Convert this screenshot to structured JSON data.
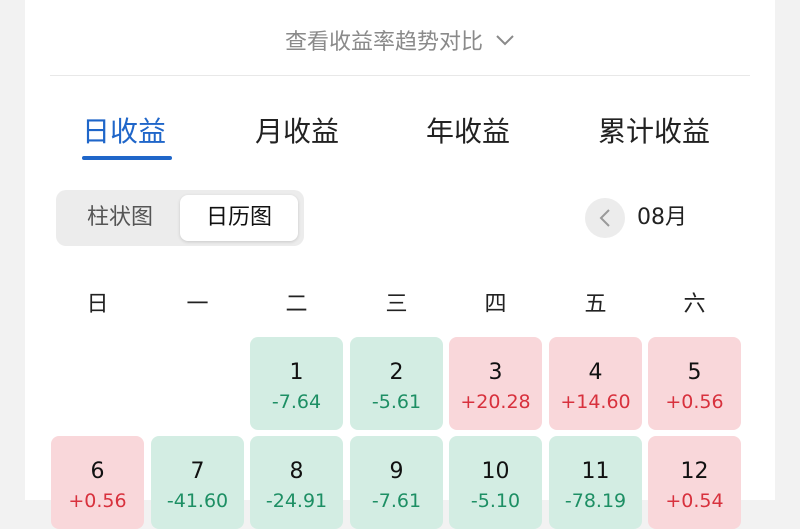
{
  "trend_link": {
    "label": "查看收益率趋势对比",
    "icon": "chevron-down-icon"
  },
  "tabs": [
    {
      "label": "日收益",
      "active": true
    },
    {
      "label": "月收益",
      "active": false
    },
    {
      "label": "年收益",
      "active": false
    },
    {
      "label": "累计收益",
      "active": false
    }
  ],
  "view_toggle": {
    "options": [
      {
        "label": "柱状图",
        "selected": false
      },
      {
        "label": "日历图",
        "selected": true
      }
    ]
  },
  "month_nav": {
    "prev_icon": "chevron-left-icon",
    "month": "08月"
  },
  "weekdays": [
    "日",
    "一",
    "二",
    "三",
    "四",
    "五",
    "六"
  ],
  "calendar": [
    {
      "day": "1",
      "value": "-7.64",
      "trend": "down",
      "col": 2,
      "week": 0
    },
    {
      "day": "2",
      "value": "-5.61",
      "trend": "down",
      "col": 3,
      "week": 0
    },
    {
      "day": "3",
      "value": "+20.28",
      "trend": "up",
      "col": 4,
      "week": 0
    },
    {
      "day": "4",
      "value": "+14.60",
      "trend": "up",
      "col": 5,
      "week": 0
    },
    {
      "day": "5",
      "value": "+0.56",
      "trend": "up",
      "col": 6,
      "week": 0
    },
    {
      "day": "6",
      "value": "+0.56",
      "trend": "up",
      "col": 0,
      "week": 1
    },
    {
      "day": "7",
      "value": "-41.60",
      "trend": "down",
      "col": 1,
      "week": 1
    },
    {
      "day": "8",
      "value": "-24.91",
      "trend": "down",
      "col": 2,
      "week": 1
    },
    {
      "day": "9",
      "value": "-7.61",
      "trend": "down",
      "col": 3,
      "week": 1
    },
    {
      "day": "10",
      "value": "-5.10",
      "trend": "down",
      "col": 4,
      "week": 1
    },
    {
      "day": "11",
      "value": "-78.19",
      "trend": "down",
      "col": 5,
      "week": 1
    },
    {
      "day": "12",
      "value": "+0.54",
      "trend": "up",
      "col": 6,
      "week": 1
    }
  ],
  "colors": {
    "accent": "#1f66c9",
    "gain_bg": "#f9d7da",
    "gain_text": "#d8313d",
    "loss_bg": "#d3ede3",
    "loss_text": "#1d8f64"
  }
}
